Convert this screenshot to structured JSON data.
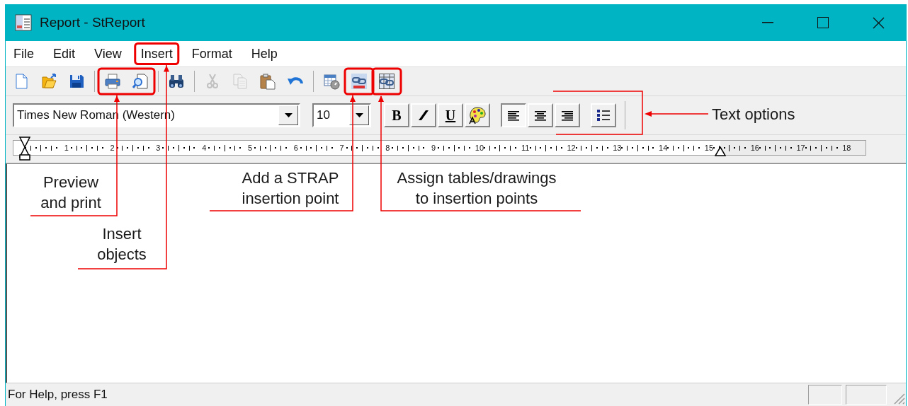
{
  "window": {
    "title": "Report - StReport"
  },
  "menu": [
    {
      "label": "File"
    },
    {
      "label": "Edit"
    },
    {
      "label": "View"
    },
    {
      "label": "Insert"
    },
    {
      "label": "Format"
    },
    {
      "label": "Help"
    }
  ],
  "toolbar": [
    {
      "kind": "new",
      "disabled": false
    },
    {
      "kind": "open",
      "disabled": false
    },
    {
      "kind": "save",
      "disabled": false
    },
    {
      "kind": "separator"
    },
    {
      "kind": "print",
      "disabled": false
    },
    {
      "kind": "preview",
      "disabled": false
    },
    {
      "kind": "separator"
    },
    {
      "kind": "find",
      "disabled": false
    },
    {
      "kind": "separator"
    },
    {
      "kind": "cut",
      "disabled": true
    },
    {
      "kind": "copy",
      "disabled": true
    },
    {
      "kind": "paste",
      "disabled": false
    },
    {
      "kind": "undo",
      "disabled": false
    },
    {
      "kind": "separator"
    },
    {
      "kind": "table-clock",
      "disabled": false
    },
    {
      "kind": "chain-link",
      "disabled": false
    },
    {
      "kind": "table-link",
      "disabled": false
    }
  ],
  "format_bar": {
    "font": "Times New Roman (Western)",
    "size": "10",
    "style_buttons": [
      {
        "kind": "bold",
        "label": "B"
      },
      {
        "kind": "italic"
      },
      {
        "kind": "underline",
        "label": "U"
      },
      {
        "kind": "color"
      }
    ],
    "alignment": [
      {
        "kind": "left",
        "selected": true
      },
      {
        "kind": "center",
        "selected": false
      },
      {
        "kind": "right",
        "selected": false
      }
    ]
  },
  "ruler": {
    "numbers": [
      "1",
      "2",
      "3",
      "4",
      "5",
      "6",
      "7",
      "8",
      "9",
      "10",
      "11",
      "12",
      "13",
      "14",
      "15",
      "16",
      "17",
      "18"
    ]
  },
  "status_bar": {
    "text": "For Help, press F1"
  },
  "callouts": [
    {
      "text": "Preview\nand print"
    },
    {
      "text": "Insert\nobjects"
    },
    {
      "text": "Add a STRAP\ninsertion point"
    },
    {
      "text": "Assign tables/drawings\nto insertion points"
    },
    {
      "text": "Text options"
    }
  ]
}
